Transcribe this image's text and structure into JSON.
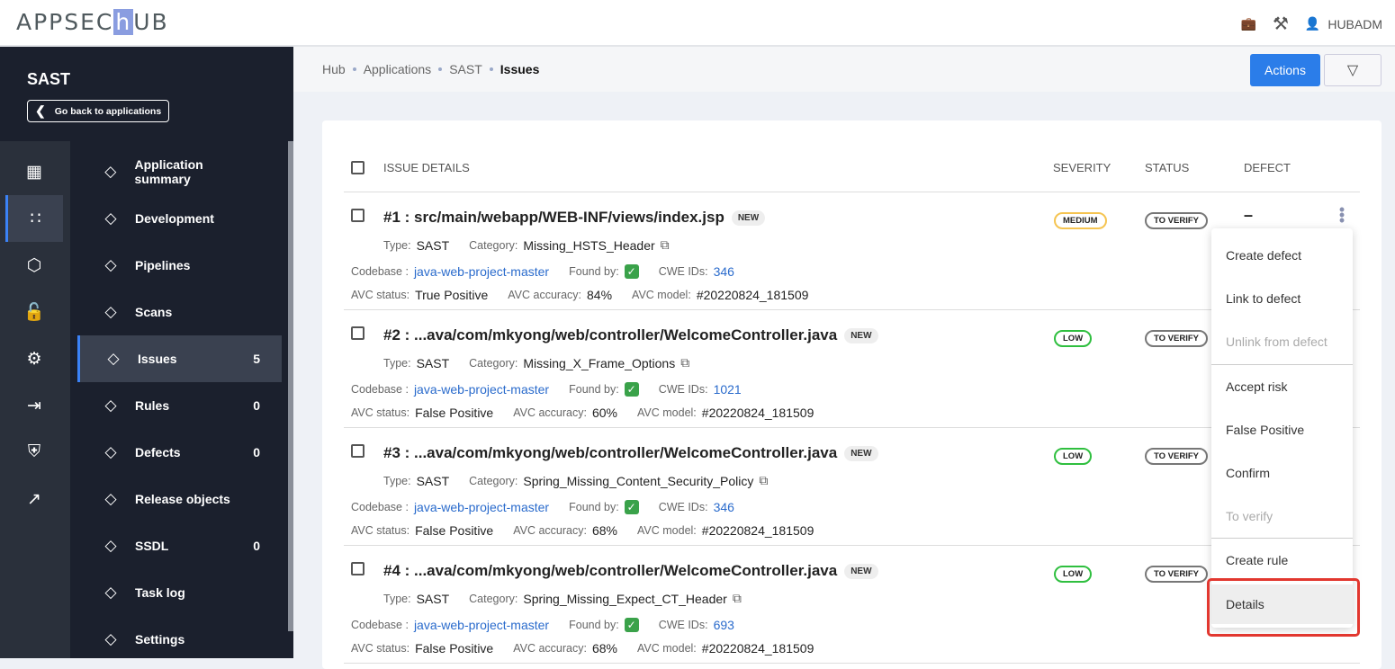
{
  "app": {
    "logo": "APPSECHUB",
    "user": "HUBADM"
  },
  "sidebar": {
    "title": "SAST",
    "back_label": "Go back to applications",
    "items": [
      {
        "label": "Application summary",
        "icon": "chart-line-icon",
        "count": ""
      },
      {
        "label": "Development",
        "icon": "code-icon",
        "count": ""
      },
      {
        "label": "Pipelines",
        "icon": "pipeline-icon",
        "count": ""
      },
      {
        "label": "Scans",
        "icon": "scan-icon",
        "count": ""
      },
      {
        "label": "Issues",
        "icon": "lock-alert-icon",
        "count": "5"
      },
      {
        "label": "Rules",
        "icon": "rules-icon",
        "count": "0"
      },
      {
        "label": "Defects",
        "icon": "bug-icon",
        "count": "0"
      },
      {
        "label": "Release objects",
        "icon": "release-icon",
        "count": ""
      },
      {
        "label": "SSDL",
        "icon": "shield-icon",
        "count": "0"
      },
      {
        "label": "Task log",
        "icon": "clipboard-icon",
        "count": ""
      },
      {
        "label": "Settings",
        "icon": "folder-gear-icon",
        "count": ""
      }
    ]
  },
  "breadcrumb": [
    "Hub",
    "Applications",
    "SAST",
    "Issues"
  ],
  "toolbar": {
    "actions_label": "Actions"
  },
  "table": {
    "headers": {
      "details": "ISSUE DETAILS",
      "severity": "SEVERITY",
      "status": "STATUS",
      "defect": "DEFECT"
    },
    "labels": {
      "type": "Type:",
      "category": "Category:",
      "codebase": "Codebase :",
      "found_by": "Found by:",
      "cwe": "CWE IDs:",
      "avc_status": "AVC status:",
      "avc_accuracy": "AVC accuracy:",
      "avc_model": "AVC model:"
    },
    "rows": [
      {
        "title": "#1 : src/main/webapp/WEB-INF/views/index.jsp",
        "badge": "NEW",
        "type": "SAST",
        "category": "Missing_HSTS_Header",
        "codebase": "java-web-project-master",
        "cwe": "346",
        "avc_status": "True Positive",
        "avc_accuracy": "84%",
        "avc_model": "#20220824_181509",
        "severity": "MEDIUM",
        "severity_color": "#f5c451",
        "status": "TO VERIFY",
        "defect": "–"
      },
      {
        "title": "#2 : ...ava/com/mkyong/web/controller/WelcomeController.java",
        "badge": "NEW",
        "type": "SAST",
        "category": "Missing_X_Frame_Options",
        "codebase": "java-web-project-master",
        "cwe": "1021",
        "avc_status": "False Positive",
        "avc_accuracy": "60%",
        "avc_model": "#20220824_181509",
        "severity": "LOW",
        "severity_color": "#2fbf3f",
        "status": "TO VERIFY",
        "defect": ""
      },
      {
        "title": "#3 : ...ava/com/mkyong/web/controller/WelcomeController.java",
        "badge": "NEW",
        "type": "SAST",
        "category": "Spring_Missing_Content_Security_Policy",
        "codebase": "java-web-project-master",
        "cwe": "346",
        "avc_status": "False Positive",
        "avc_accuracy": "68%",
        "avc_model": "#20220824_181509",
        "severity": "LOW",
        "severity_color": "#2fbf3f",
        "status": "TO VERIFY",
        "defect": ""
      },
      {
        "title": "#4 : ...ava/com/mkyong/web/controller/WelcomeController.java",
        "badge": "NEW",
        "type": "SAST",
        "category": "Spring_Missing_Expect_CT_Header",
        "codebase": "java-web-project-master",
        "cwe": "693",
        "avc_status": "False Positive",
        "avc_accuracy": "68%",
        "avc_model": "#20220824_181509",
        "severity": "LOW",
        "severity_color": "#2fbf3f",
        "status": "TO VERIFY",
        "defect": ""
      }
    ]
  },
  "menu": {
    "items": [
      {
        "label": "Create defect",
        "disabled": false
      },
      {
        "label": "Link to defect",
        "disabled": false
      },
      {
        "label": "Unlink from defect",
        "disabled": true
      },
      {
        "label": "Accept risk",
        "disabled": false
      },
      {
        "label": "False Positive",
        "disabled": false
      },
      {
        "label": "Confirm",
        "disabled": false
      },
      {
        "label": "To verify",
        "disabled": true
      },
      {
        "label": "Create rule",
        "disabled": false
      },
      {
        "label": "Details",
        "disabled": false,
        "highlighted": true
      }
    ]
  }
}
